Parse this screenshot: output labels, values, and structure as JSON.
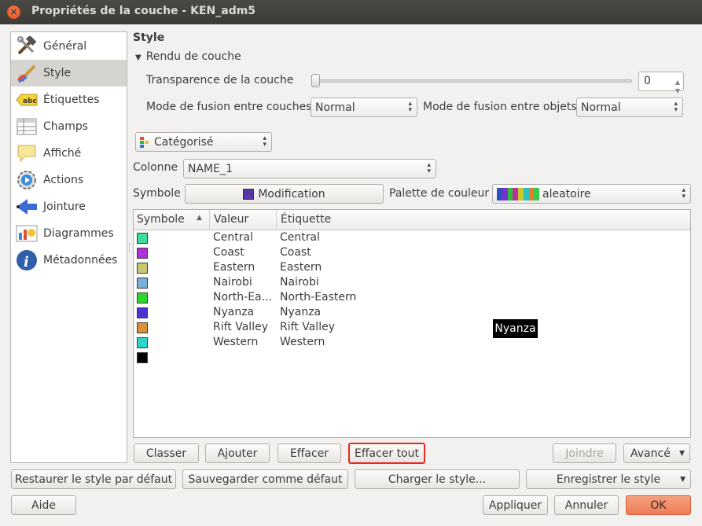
{
  "window": {
    "title": "Propriétés de la couche - KEN_adm5",
    "close_icon": "×"
  },
  "sidebar": {
    "items": [
      {
        "label": "Général",
        "icon": "hammer-wrench-icon"
      },
      {
        "label": "Style",
        "icon": "paintbrush-icon",
        "active": true
      },
      {
        "label": "Étiquettes",
        "icon": "abc-label-icon"
      },
      {
        "label": "Champs",
        "icon": "table-grid-icon"
      },
      {
        "label": "Affiché",
        "icon": "speech-bubble-icon"
      },
      {
        "label": "Actions",
        "icon": "gear-play-icon"
      },
      {
        "label": "Jointure",
        "icon": "join-arrow-icon"
      },
      {
        "label": "Diagrammes",
        "icon": "diagram-chart-icon"
      },
      {
        "label": "Métadonnées",
        "icon": "info-icon"
      }
    ]
  },
  "style": {
    "section_title": "Style",
    "render_group": "Rendu de couche",
    "transparency_label": "Transparence de la couche",
    "transparency_value": "0",
    "transparency_level": 0,
    "blend_layers_label": "Mode de fusion entre couches",
    "blend_layers_value": "Normal",
    "blend_objects_label": "Mode de fusion entre objets",
    "blend_objects_value": "Normal",
    "renderer_value": "Catégorisé",
    "column_label": "Colonne",
    "column_value": "NAME_1",
    "symbol_label": "Symbole",
    "symbol_button": "Modification",
    "symbol_color": "#5b37a6",
    "palette_label": "Palette de couleur",
    "palette_value": "aleatoire",
    "palette_colors": [
      "#2f4fbf",
      "#7a2fd0",
      "#2fbf3a",
      "#bf2f9a",
      "#c9c92f",
      "#2fbfbf",
      "#e07b2f",
      "#3ac94a"
    ]
  },
  "table": {
    "headers": {
      "symbol": "Symbole",
      "value": "Valeur",
      "label": "Étiquette",
      "sort_icon": "▲"
    },
    "rows": [
      {
        "color": "#3ddc97",
        "value": "Central",
        "label": "Central"
      },
      {
        "color": "#b02fdc",
        "value": "Coast",
        "label": "Coast"
      },
      {
        "color": "#c8c870",
        "value": "Eastern",
        "label": "Eastern"
      },
      {
        "color": "#7ab0d8",
        "value": "Nairobi",
        "label": "Nairobi"
      },
      {
        "color": "#2fd62f",
        "value": "North-Ea...",
        "label": "North-Eastern"
      },
      {
        "color": "#4f2fd6",
        "value": "Nyanza",
        "label": "Nyanza"
      },
      {
        "color": "#d9903a",
        "value": "Rift Valley",
        "label": "Rift Valley"
      },
      {
        "color": "#2fd6c8",
        "value": "Western",
        "label": "Western"
      },
      {
        "color": "#000000",
        "value": "",
        "label": ""
      }
    ],
    "tooltip": "Nyanza"
  },
  "buttons": {
    "classer": "Classer",
    "ajouter": "Ajouter",
    "effacer": "Effacer",
    "effacer_tout": "Effacer tout",
    "joindre": "Joindre",
    "avance": "Avancé",
    "restore": "Restaurer le style par défaut",
    "save_default": "Sauvegarder comme défaut",
    "load_style": "Charger le style...",
    "save_style": "Enregistrer le style",
    "help": "Aide",
    "apply": "Appliquer",
    "cancel": "Annuler",
    "ok": "OK"
  },
  "colors": {
    "highlight_border": "#e8281e",
    "ok_button": "#f08a65",
    "ok_border": "#d4623c"
  }
}
